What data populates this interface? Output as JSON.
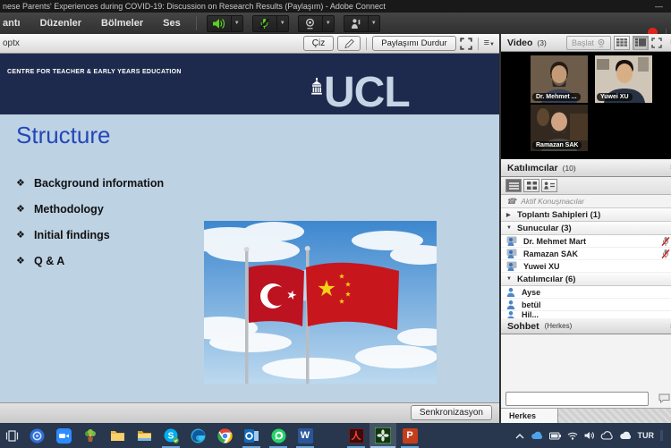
{
  "window": {
    "title": "nese Parents' Experiences during COVID-19: Discussion on Research Results (Paylaşım) - Adobe Connect",
    "minimize_glyph": "—",
    "menu_items": [
      "antı",
      "Düzenler",
      "Bölmeler",
      "Ses"
    ]
  },
  "share_pod": {
    "filename": "optx",
    "draw_button": "Çiz",
    "stop_share_button": "Paylaşımı Durdur",
    "sync_button": "Senkronizasyon"
  },
  "slide": {
    "banner": "CENTRE FOR TEACHER & EARLY YEARS EDUCATION",
    "logo_text": "UCL",
    "title": "Structure",
    "bullet_glyph": "❖",
    "bullets": [
      "Background information",
      "Methodology",
      "Initial findings",
      "Q & A"
    ]
  },
  "video_pod": {
    "title": "Video",
    "count": "(3)",
    "start_button": "Başlat",
    "tiles": [
      {
        "name": "Dr. Mehmet ..."
      },
      {
        "name": "Yuwei XU"
      },
      {
        "name": "Ramazan SAK"
      }
    ]
  },
  "attendees_pod": {
    "title": "Katılımcılar",
    "count": "(10)",
    "active_speakers_label": "Aktif Konuşmacılar",
    "hosts_group": "Toplantı Sahipleri (1)",
    "presenters_group": "Sunucular (3)",
    "presenters": [
      "Dr. Mehmet Mart",
      "Ramazan SAK",
      "Yuwei XU"
    ],
    "participants_group": "Katılımcılar (6)",
    "participants": [
      "Ayse",
      "betül",
      "Hil..."
    ]
  },
  "chat_pod": {
    "title": "Sohbet",
    "scope": "(Herkes)",
    "tab_label": "Herkes",
    "input_value": ""
  },
  "taskbar": {
    "language": "TUR"
  },
  "colors": {
    "slide_navy": "#1e2a4d",
    "slide_light_blue": "#bdd2e3",
    "slide_title_blue": "#2347b8",
    "taskbar_bg": "#28374d",
    "toolbar_green": "#5bd01f",
    "record_red": "#e0241b"
  }
}
